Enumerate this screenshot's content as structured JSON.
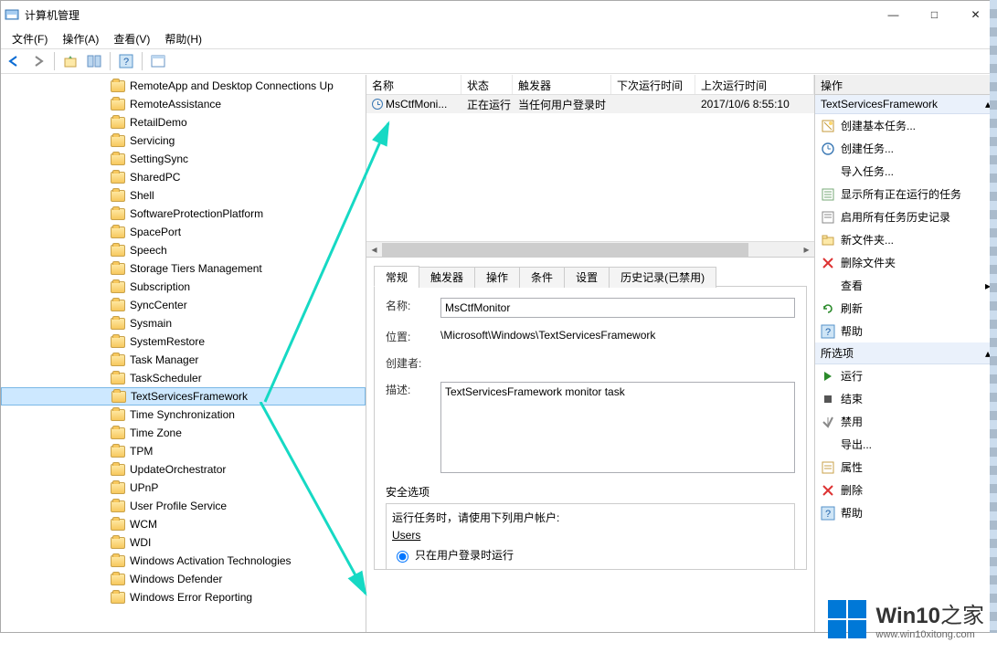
{
  "window": {
    "title": "计算机管理",
    "min": "—",
    "max": "□",
    "close": "✕"
  },
  "menu": {
    "file": "文件(F)",
    "action": "操作(A)",
    "view": "查看(V)",
    "help": "帮助(H)"
  },
  "tree": {
    "items": [
      "RemoteApp and Desktop Connections Up",
      "RemoteAssistance",
      "RetailDemo",
      "Servicing",
      "SettingSync",
      "SharedPC",
      "Shell",
      "SoftwareProtectionPlatform",
      "SpacePort",
      "Speech",
      "Storage Tiers Management",
      "Subscription",
      "SyncCenter",
      "Sysmain",
      "SystemRestore",
      "Task Manager",
      "TaskScheduler",
      "TextServicesFramework",
      "Time Synchronization",
      "Time Zone",
      "TPM",
      "UpdateOrchestrator",
      "UPnP",
      "User Profile Service",
      "WCM",
      "WDI",
      "Windows Activation Technologies",
      "Windows Defender",
      "Windows Error Reporting"
    ],
    "selected_index": 17
  },
  "list": {
    "cols": {
      "name": "名称",
      "state": "状态",
      "trigger": "触发器",
      "next": "下次运行时间",
      "last": "上次运行时间"
    },
    "row": {
      "name": "MsCtfMoni...",
      "state": "正在运行",
      "trigger": "当任何用户登录时",
      "next": "",
      "last": "2017/10/6 8:55:10"
    }
  },
  "tabs": {
    "general": "常规",
    "triggers": "触发器",
    "ops": "操作",
    "cond": "条件",
    "settings": "设置",
    "history": "历史记录(已禁用)"
  },
  "detail": {
    "name_label": "名称:",
    "name_val": "MsCtfMonitor",
    "loc_label": "位置:",
    "loc_val": "\\Microsoft\\Windows\\TextServicesFramework",
    "creator_label": "创建者:",
    "creator_val": "",
    "desc_label": "描述:",
    "desc_val": "TextServicesFramework monitor task",
    "sec_title": "安全选项",
    "sec_hint": "运行任务时，请使用下列用户帐户:",
    "sec_user": "Users",
    "radio1": "只在用户登录时运行"
  },
  "actions": {
    "header": "操作",
    "section1": "TextServicesFramework",
    "items1": [
      {
        "icon": "wizard",
        "label": "创建基本任务..."
      },
      {
        "icon": "create",
        "label": "创建任务..."
      },
      {
        "icon": "",
        "label": "导入任务..."
      },
      {
        "icon": "list",
        "label": "显示所有正在运行的任务"
      },
      {
        "icon": "history",
        "label": "启用所有任务历史记录"
      },
      {
        "icon": "newfolder",
        "label": "新文件夹..."
      },
      {
        "icon": "delete",
        "label": "删除文件夹"
      },
      {
        "icon": "",
        "label": "查看",
        "arrow": true
      },
      {
        "icon": "refresh",
        "label": "刷新"
      },
      {
        "icon": "help",
        "label": "帮助"
      }
    ],
    "section2": "所选项",
    "items2": [
      {
        "icon": "run",
        "label": "运行"
      },
      {
        "icon": "stop",
        "label": "结束"
      },
      {
        "icon": "disable",
        "label": "禁用"
      },
      {
        "icon": "",
        "label": "导出..."
      },
      {
        "icon": "props",
        "label": "属性"
      },
      {
        "icon": "delete",
        "label": "删除"
      },
      {
        "icon": "help",
        "label": "帮助"
      }
    ]
  },
  "watermark": {
    "brand": "Win10",
    "suffix": "之家",
    "url": "www.win10xitong.com"
  }
}
